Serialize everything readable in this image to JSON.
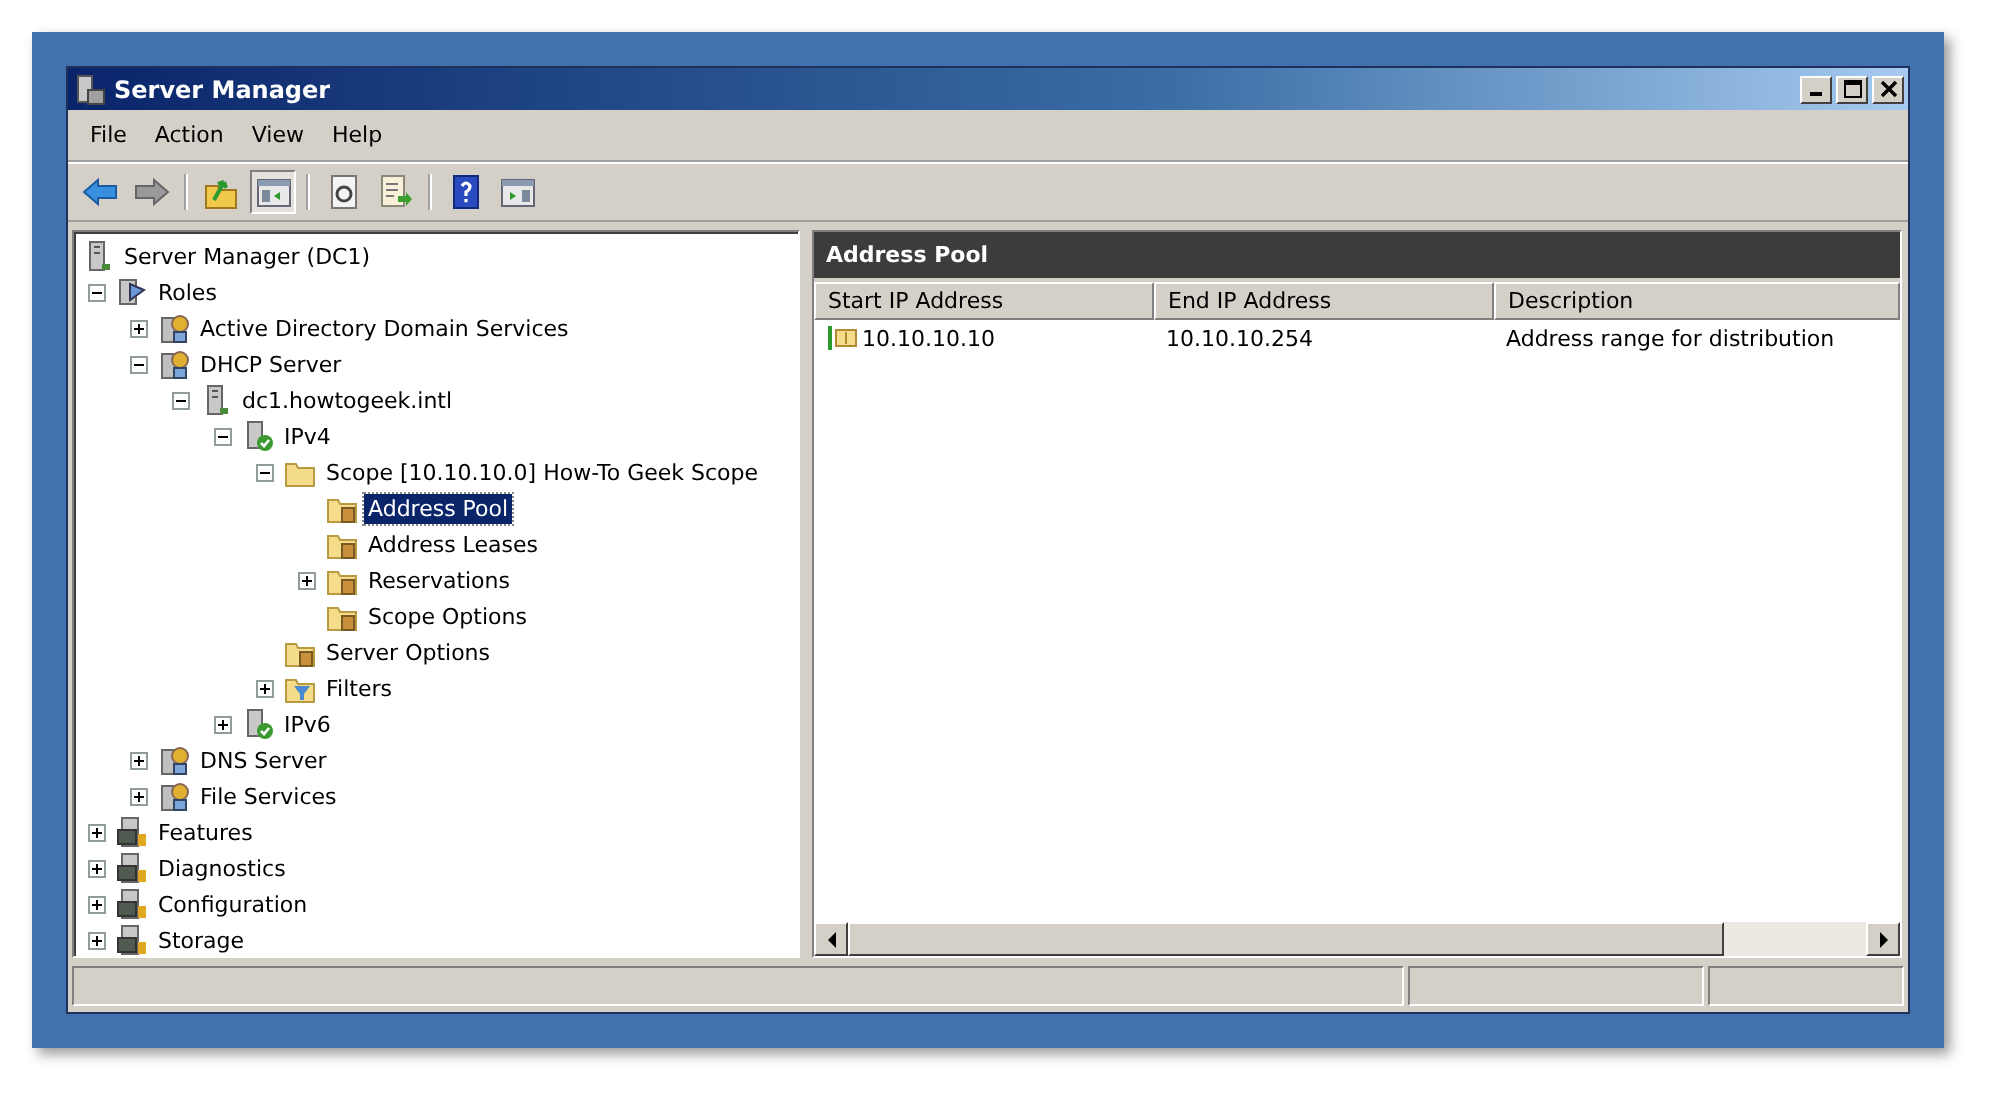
{
  "window": {
    "title": "Server Manager"
  },
  "menu": [
    "File",
    "Action",
    "View",
    "Help"
  ],
  "toolbar": [
    {
      "kind": "back",
      "pressed": false
    },
    {
      "kind": "forward",
      "pressed": false
    },
    {
      "kind": "up",
      "pressed": false
    },
    {
      "kind": "console-tree",
      "pressed": true
    },
    {
      "kind": "refresh",
      "pressed": false
    },
    {
      "kind": "export",
      "pressed": false
    },
    {
      "kind": "help",
      "pressed": false
    },
    {
      "kind": "action-pane",
      "pressed": false
    }
  ],
  "tree": {
    "label": "Server Manager (DC1)",
    "kind": "computer",
    "selected": false,
    "children": [
      {
        "label": "Roles",
        "kind": "roles",
        "selected": false,
        "expanded": true,
        "children": [
          {
            "label": "Active Directory Domain Services",
            "kind": "role",
            "selected": false,
            "expanded": false
          },
          {
            "label": "DHCP Server",
            "kind": "role",
            "selected": false,
            "expanded": true,
            "children": [
              {
                "label": "dc1.howtogeek.intl",
                "kind": "computer",
                "selected": false,
                "expanded": true,
                "children": [
                  {
                    "label": "IPv4",
                    "kind": "server-ok",
                    "selected": false,
                    "expanded": true,
                    "children": [
                      {
                        "label": "Scope [10.10.10.0] How-To Geek Scope",
                        "kind": "folder",
                        "selected": false,
                        "expanded": true,
                        "children": [
                          {
                            "label": "Address Pool",
                            "kind": "folder-item",
                            "selected": true
                          },
                          {
                            "label": "Address Leases",
                            "kind": "folder-item",
                            "selected": false
                          },
                          {
                            "label": "Reservations",
                            "kind": "folder-item",
                            "selected": false,
                            "expanded": false
                          },
                          {
                            "label": "Scope Options",
                            "kind": "folder-item",
                            "selected": false
                          }
                        ]
                      },
                      {
                        "label": "Server Options",
                        "kind": "folder-item",
                        "selected": false
                      },
                      {
                        "label": "Filters",
                        "kind": "filter",
                        "selected": false,
                        "expanded": false
                      }
                    ]
                  },
                  {
                    "label": "IPv6",
                    "kind": "server-ok",
                    "selected": false,
                    "expanded": false
                  }
                ]
              }
            ]
          },
          {
            "label": "DNS Server",
            "kind": "role",
            "selected": false,
            "expanded": false
          },
          {
            "label": "File Services",
            "kind": "role",
            "selected": false,
            "expanded": false
          }
        ]
      },
      {
        "label": "Features",
        "kind": "tool",
        "selected": false,
        "expanded": false
      },
      {
        "label": "Diagnostics",
        "kind": "tool",
        "selected": false,
        "expanded": false
      },
      {
        "label": "Configuration",
        "kind": "tool",
        "selected": false,
        "expanded": false
      },
      {
        "label": "Storage",
        "kind": "tool",
        "selected": false,
        "expanded": false
      }
    ]
  },
  "pane": {
    "title": "Address Pool",
    "columns": [
      "Start IP Address",
      "End IP Address",
      "Description"
    ],
    "rows": [
      [
        "10.10.10.10",
        "10.10.10.254",
        "Address range for distribution"
      ]
    ]
  }
}
